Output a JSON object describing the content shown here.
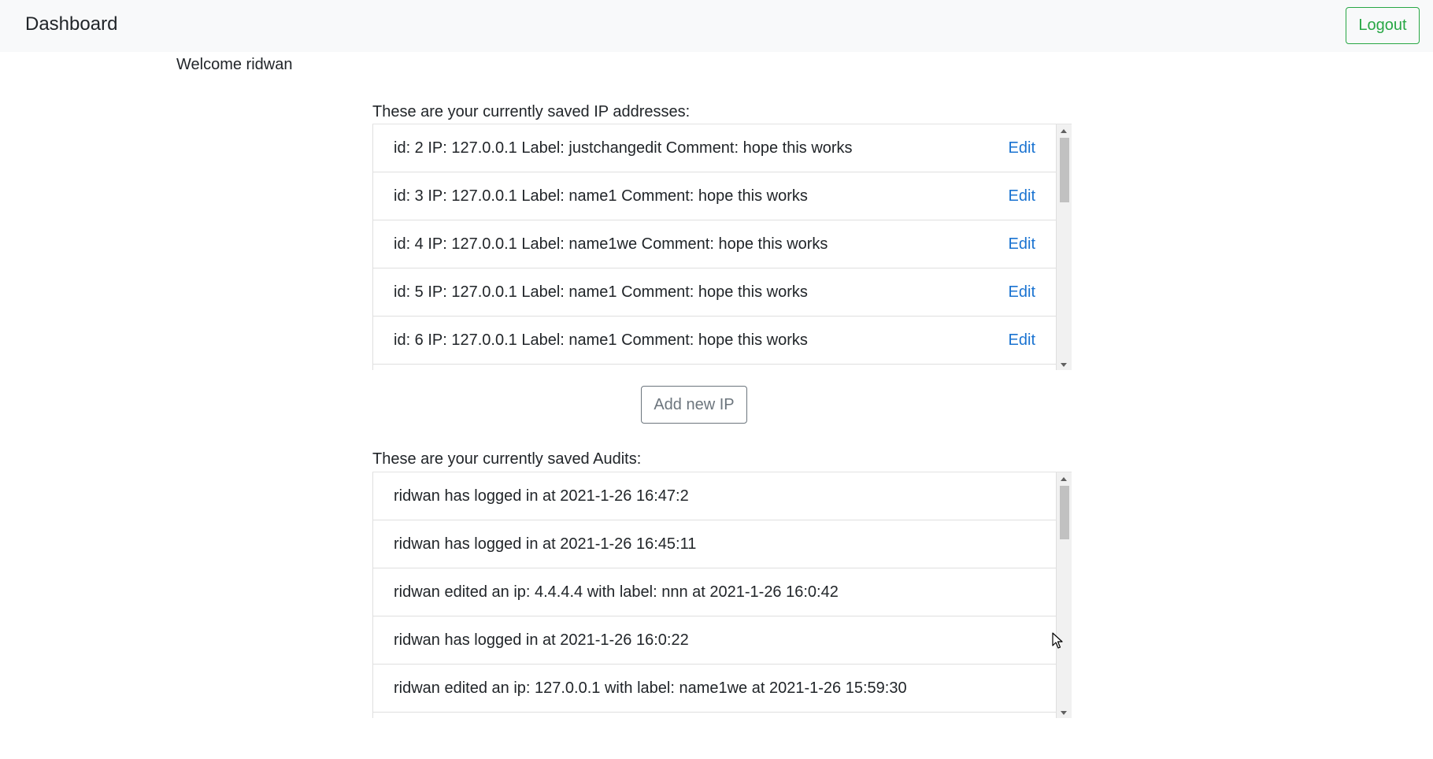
{
  "navbar": {
    "brand": "Dashboard",
    "logout_label": "Logout"
  },
  "welcome": "Welcome ridwan",
  "ips": {
    "title": "These are your currently saved IP addresses:",
    "rows": [
      {
        "text": "id: 2 IP: 127.0.0.1 Label: justchangedit Comment: hope this works",
        "action": "Edit"
      },
      {
        "text": "id: 3 IP: 127.0.0.1 Label: name1 Comment: hope this works",
        "action": "Edit"
      },
      {
        "text": "id: 4 IP: 127.0.0.1 Label: name1we Comment: hope this works",
        "action": "Edit"
      },
      {
        "text": "id: 5 IP: 127.0.0.1 Label: name1 Comment: hope this works",
        "action": "Edit"
      },
      {
        "text": "id: 6 IP: 127.0.0.1 Label: name1 Comment: hope this works",
        "action": "Edit"
      }
    ],
    "add_label": "Add new IP"
  },
  "audits": {
    "title": "These are your currently saved Audits:",
    "rows": [
      {
        "text": "ridwan has logged in at 2021-1-26 16:47:2"
      },
      {
        "text": "ridwan has logged in at 2021-1-26 16:45:11"
      },
      {
        "text": "ridwan edited an ip: 4.4.4.4 with label: nnn at 2021-1-26 16:0:42"
      },
      {
        "text": "ridwan has logged in at 2021-1-26 16:0:22"
      },
      {
        "text": "ridwan edited an ip: 127.0.0.1 with label: name1we at 2021-1-26 15:59:30"
      }
    ]
  },
  "colors": {
    "navbar_bg": "#f8f9fa",
    "logout_accent": "#28a745",
    "link": "#1a73d1",
    "secondary": "#6c757d"
  },
  "icons": [
    "scroll-up-arrow-icon",
    "scroll-down-arrow-icon",
    "mouse-pointer-icon"
  ]
}
